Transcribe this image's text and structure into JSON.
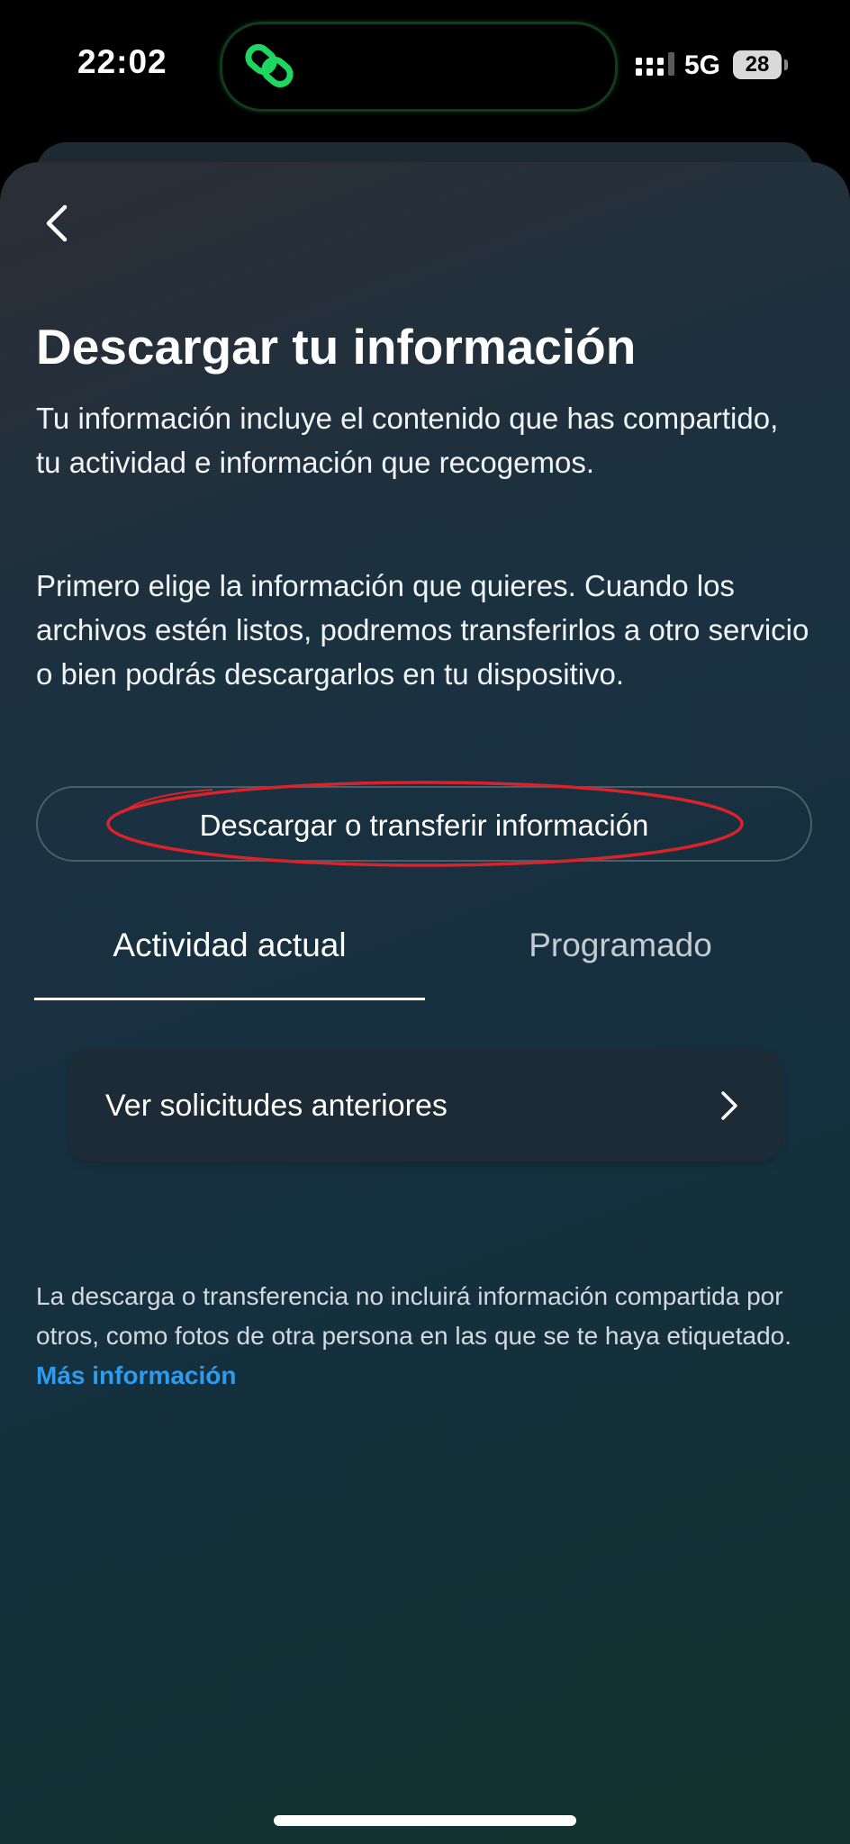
{
  "status_bar": {
    "time": "22:02",
    "network": "5G",
    "battery": "28"
  },
  "header": {
    "title": "Descargar tu información"
  },
  "content": {
    "paragraph_1": "Tu información incluye el contenido que has compartido, tu actividad e información que recogemos.",
    "paragraph_2": "Primero elige la información que quieres. Cuando los archivos estén listos, podremos transferirlos a otro servicio o bien podrás descargarlos en tu dispositivo.",
    "primary_button_label": "Descargar o transferir información"
  },
  "tabs": [
    {
      "label": "Actividad actual",
      "selected": true
    },
    {
      "label": "Programado",
      "selected": false
    }
  ],
  "list": {
    "past_requests_label": "Ver solicitudes anteriores"
  },
  "footer": {
    "note": "La descarga o transferencia no incluirá información compartida por otros, como fotos de otra persona en las que se te haya etiquetado. ",
    "link": "Más información"
  },
  "colors": {
    "link": "#2d9bf0",
    "annotation": "#d9232a",
    "island_accent": "#1ed760"
  },
  "icons": [
    "link-chain-icon",
    "signal-icon",
    "battery-icon",
    "back-chevron-icon",
    "chevron-right-icon"
  ]
}
